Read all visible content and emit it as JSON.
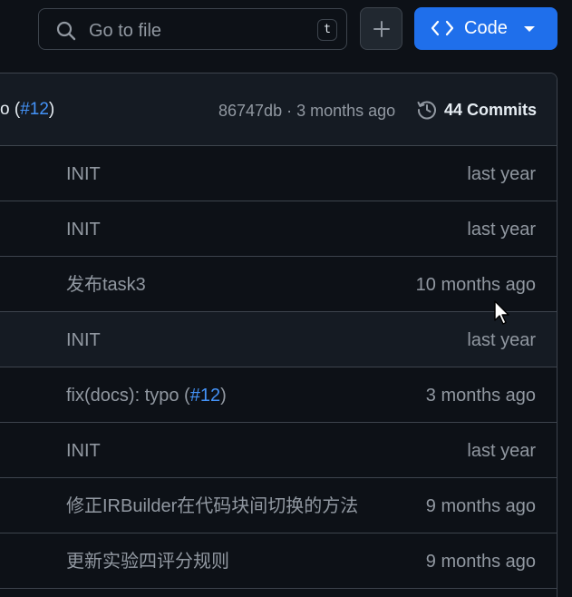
{
  "search": {
    "placeholder": "Go to file",
    "shortcut_key": "t"
  },
  "toolbar": {
    "add_label": "+",
    "code_label": "Code"
  },
  "latest_commit": {
    "message_prefix": "o (",
    "pr_link": "#12",
    "message_suffix": ")",
    "meta": "86747db · 3 months ago",
    "commits_label": "44 Commits"
  },
  "rows": [
    {
      "message": "INIT",
      "date": "last year"
    },
    {
      "message": "INIT",
      "date": "last year"
    },
    {
      "message": "发布task3",
      "date": "10 months ago"
    },
    {
      "message": "INIT",
      "date": "last year"
    },
    {
      "message_prefix": "fix(docs): typo (",
      "pr_link": "#12",
      "message_suffix": ")",
      "date": "3 months ago"
    },
    {
      "message": "INIT",
      "date": "last year"
    },
    {
      "message": "修正IRBuilder在代码块间切换的方法",
      "date": "9 months ago"
    },
    {
      "message": "更新实验四评分规则",
      "date": "9 months ago"
    }
  ],
  "colors": {
    "background": "#0d1117",
    "header_bg": "#151b23",
    "border": "#3d444d",
    "primary_button": "#1f6feb",
    "link": "#4493f8",
    "muted_text": "#9198a1"
  },
  "icons": [
    "search-icon",
    "plus-icon",
    "code-icon",
    "caret-down-icon",
    "history-icon",
    "mouse-cursor-icon"
  ]
}
